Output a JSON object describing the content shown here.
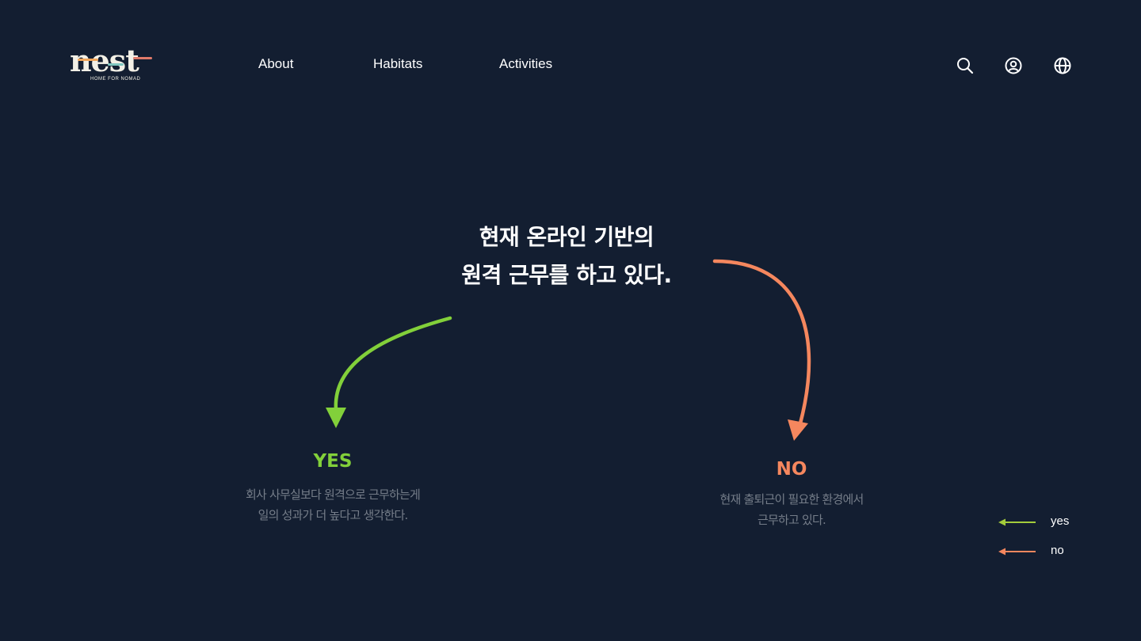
{
  "header": {
    "logo": {
      "word": "nest",
      "tagline": "HOME FOR NOMAD"
    },
    "nav": [
      {
        "label": "About"
      },
      {
        "label": "Habitats"
      },
      {
        "label": "Activities"
      }
    ],
    "icons": [
      "search-icon",
      "user-icon",
      "globe-icon"
    ]
  },
  "question": {
    "line1": "현재 온라인 기반의",
    "line2": "원격 근무를 하고 있다."
  },
  "answers": {
    "yes": {
      "title": "YES",
      "desc_line1": "회사 사무실보다 원격으로 근무하는게",
      "desc_line2": "일의 성과가 더 높다고 생각한다.",
      "color": "#82d03a"
    },
    "no": {
      "title": "NO",
      "desc_line1": "현재 출퇴근이 필요한 환경에서",
      "desc_line2": "근무하고 있다.",
      "color": "#f5875e"
    }
  },
  "legend": [
    {
      "label": "yes",
      "color": "#a3cc3b"
    },
    {
      "label": "no",
      "color": "#f5875e"
    }
  ],
  "colors": {
    "background": "#131e31",
    "text": "#ffffff",
    "muted_text": "#757d89"
  }
}
